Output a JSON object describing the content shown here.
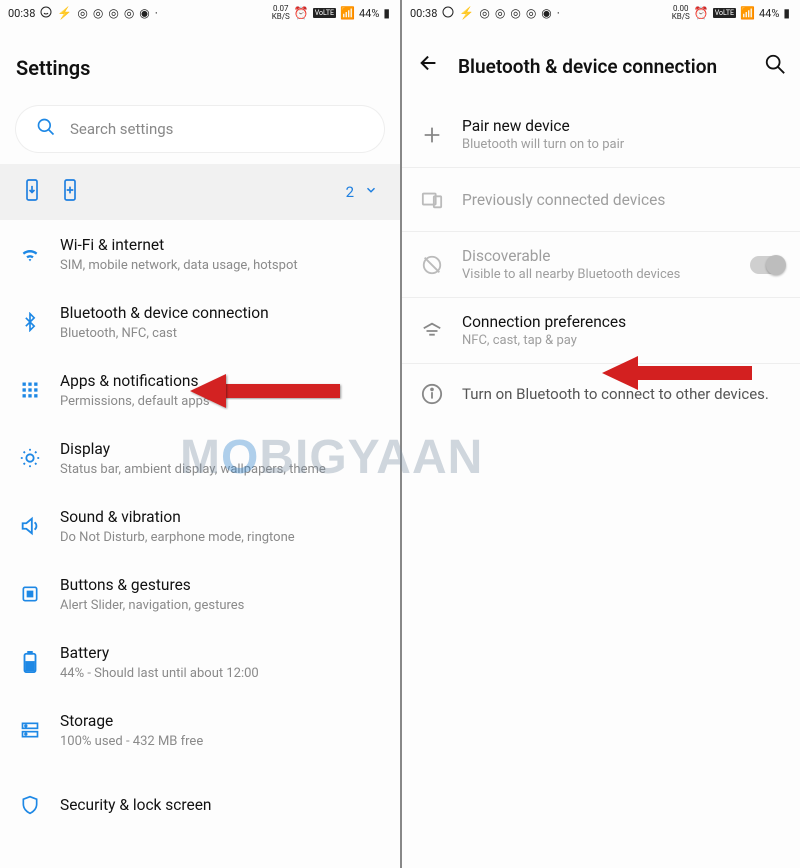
{
  "status": {
    "time": "00:38",
    "kbs_left": "0.07",
    "kbs_right": "0.00",
    "kbs_unit": "KB/S",
    "volte": "VoLTE",
    "net": "4G",
    "battery": "44%"
  },
  "left": {
    "title": "Settings",
    "search_placeholder": "Search settings",
    "suggestion_count": "2",
    "items": [
      {
        "icon": "wifi",
        "title": "Wi-Fi & internet",
        "sub": "SIM, mobile network, data usage, hotspot"
      },
      {
        "icon": "bluetooth",
        "title": "Bluetooth & device connection",
        "sub": "Bluetooth, NFC, cast"
      },
      {
        "icon": "apps",
        "title": "Apps & notifications",
        "sub": "Permissions, default apps"
      },
      {
        "icon": "display",
        "title": "Display",
        "sub": "Status bar, ambient display, wallpapers, theme"
      },
      {
        "icon": "sound",
        "title": "Sound & vibration",
        "sub": "Do Not Disturb, earphone mode, ringtone"
      },
      {
        "icon": "buttons",
        "title": "Buttons & gestures",
        "sub": "Alert Slider, navigation, gestures"
      },
      {
        "icon": "battery",
        "title": "Battery",
        "sub": "44% - Should last until about 12:00"
      },
      {
        "icon": "storage",
        "title": "Storage",
        "sub": "100% used - 432 MB free"
      },
      {
        "icon": "security",
        "title": "Security & lock screen",
        "sub": ""
      }
    ]
  },
  "right": {
    "title": "Bluetooth & device connection",
    "items": [
      {
        "title": "Pair new device",
        "sub": "Bluetooth will turn on to pair",
        "icon": "plus",
        "disabled": false
      },
      {
        "title": "Previously connected devices",
        "sub": "",
        "icon": "devices",
        "disabled": true
      },
      {
        "title": "Discoverable",
        "sub": "Visible to all nearby Bluetooth devices",
        "icon": "discover",
        "disabled": true,
        "toggle": true
      },
      {
        "title": "Connection preferences",
        "sub": "NFC, cast, tap & pay",
        "icon": "prefs",
        "disabled": false
      }
    ],
    "info": "Turn on Bluetooth to connect to other devices."
  },
  "watermark": {
    "pre": "M",
    "o": "O",
    "post": "BIGYAAN"
  }
}
